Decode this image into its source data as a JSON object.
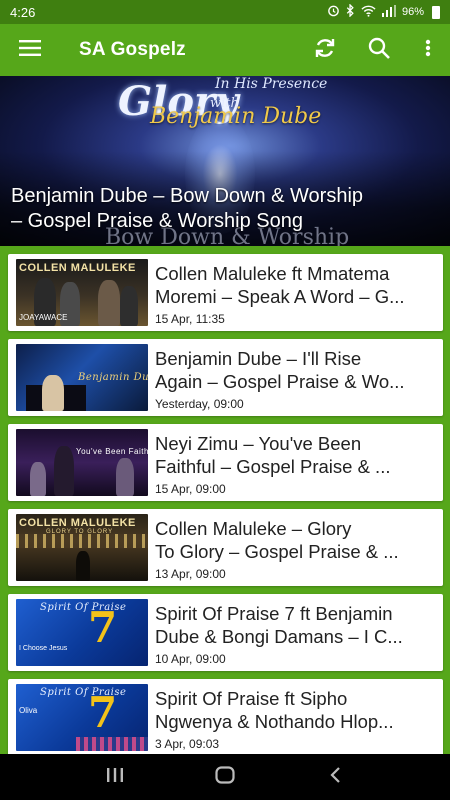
{
  "status_bar": {
    "time": "4:26",
    "battery": "96%",
    "icons": [
      "alarm-icon",
      "bluetooth-icon",
      "wifi-icon",
      "signal-icon",
      "battery-icon"
    ]
  },
  "app_bar": {
    "title": "SA Gospelz",
    "icons": [
      "menu-icon",
      "refresh-icon",
      "search-icon",
      "more-vert-icon"
    ],
    "color": "#56a71a"
  },
  "featured": {
    "title_line1": "Benjamin Dube – Bow Down & Worship",
    "title_line2": "– Gospel Praise & Worship Song",
    "art_text_glory": "Glory",
    "art_text_presence": "In His Presence",
    "art_text_with": "with",
    "art_text_artist": "Benjamin Dube",
    "art_text_ghost": "Bow Down & Worship"
  },
  "posts": [
    {
      "title_line1": "Collen Maluleke ft Mmatema",
      "title_line2": "Moremi – Speak A Word – G...",
      "date": "15 Apr, 11:35",
      "thumb_text": "COLLEN MALULEKE",
      "thumb_sub": "JOAYAWACE"
    },
    {
      "title_line1": "Benjamin Dube – I'll Rise",
      "title_line2": "Again – Gospel Praise & Wo...",
      "date": "Yesterday, 09:00",
      "thumb_text": "Benjamin Dube",
      "thumb_sub": ""
    },
    {
      "title_line1": "Neyi Zimu – You've Been",
      "title_line2": "Faithful – Gospel Praise & ...",
      "date": "15 Apr, 09:00",
      "thumb_text": "You've Been Faithful",
      "thumb_sub": ""
    },
    {
      "title_line1": "Collen Maluleke – Glory",
      "title_line2": "To Glory – Gospel Praise & ...",
      "date": "13 Apr, 09:00",
      "thumb_text": "COLLEN MALULEKE",
      "thumb_sub": "GLORY TO GLORY"
    },
    {
      "title_line1": "Spirit Of Praise 7 ft Benjamin",
      "title_line2": "Dube & Bongi Damans – I C...",
      "date": "10 Apr, 09:00",
      "thumb_text": "Spirit Of Praise",
      "thumb_sub": "I Choose Jesus"
    },
    {
      "title_line1": "Spirit Of Praise ft Sipho",
      "title_line2": "Ngwenya & Nothando Hlop...",
      "date": "3 Apr, 09:03",
      "thumb_text": "Spirit Of Praise",
      "thumb_sub": "Oliva"
    }
  ],
  "nav_bar": {
    "icons": [
      "recents-icon",
      "home-icon",
      "back-icon"
    ]
  }
}
